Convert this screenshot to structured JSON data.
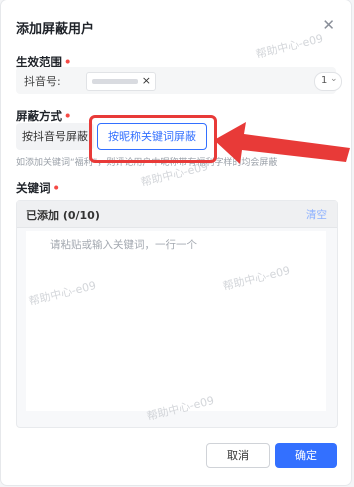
{
  "dialog": {
    "title": "添加屏蔽用户"
  },
  "scope": {
    "label": "生效范围",
    "field_label": "抖音号:",
    "tag_remove": "×",
    "count": "1",
    "count_chevron": "⌄"
  },
  "mode": {
    "label": "屏蔽方式",
    "options": [
      "按抖音号屏蔽",
      "按昵称关键词屏蔽"
    ],
    "hint": "如添加关键词“福利”，则评论用户中昵称带有福利字样的均会屏蔽"
  },
  "keywords": {
    "label": "关键词",
    "added": "已添加 (0/10)",
    "clear": "清空",
    "placeholder": "请粘贴或输入关键词，一行一个"
  },
  "footer": {
    "cancel": "取消",
    "confirm": "确定"
  },
  "watermark": "帮助中心-e09",
  "colors": {
    "primary": "#3370ff",
    "required": "#f54a45",
    "annotation": "#e83a38"
  },
  "icons": {
    "close": "close-icon",
    "chevron": "chevron-down-icon"
  }
}
